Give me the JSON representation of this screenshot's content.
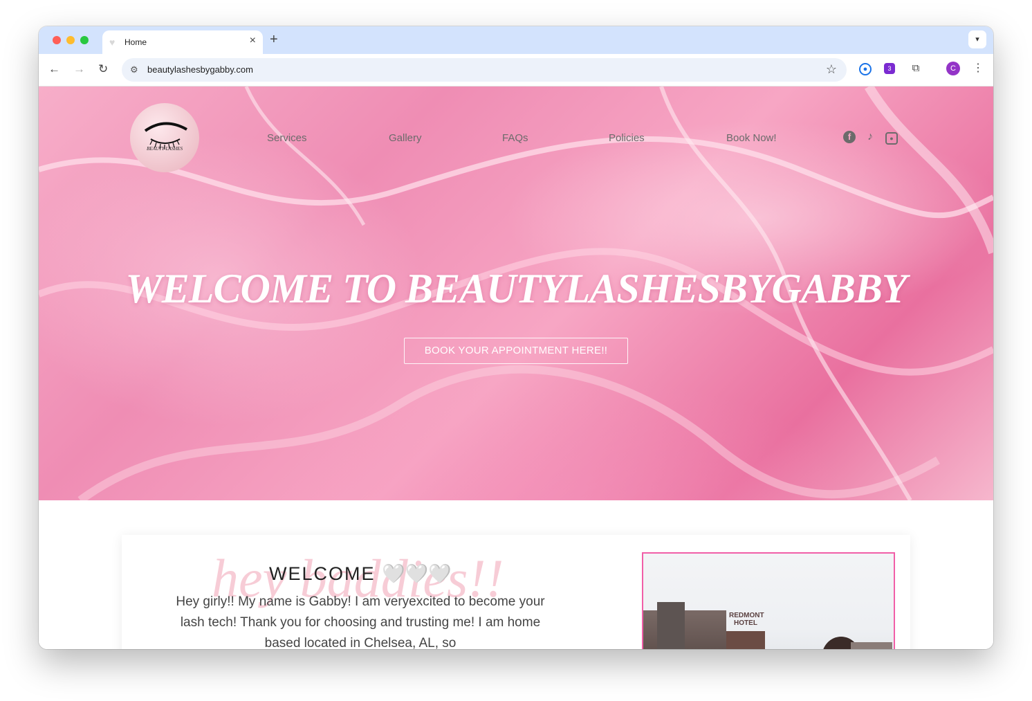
{
  "browser": {
    "tab_title": "Home",
    "new_tab_label": "+",
    "url": "beautylashesbygabby.com",
    "extension_badge": "3",
    "profile_initial": "C"
  },
  "site": {
    "logo_text": "BEAUTY LASHES",
    "nav": [
      "Services",
      "Gallery",
      "FAQs",
      "Policies",
      "Book Now!"
    ],
    "social_icons": [
      "facebook-icon",
      "tiktok-icon",
      "instagram-icon"
    ],
    "hero": {
      "title": "WELCOME TO BEAUTYLASHESBYGABBY",
      "cta": "BOOK YOUR APPOINTMENT HERE!!"
    },
    "intro": {
      "script_text": "hey baddies!!",
      "heading": "WELCOME",
      "heading_hearts": "🤍🤍🤍",
      "body": "Hey girly!! My name is Gabby! I am veryexcited to become your lash tech! Thank you for choosing and trusting me! I am home based located in Chelsea, AL, so",
      "photo_sign": "REDMONT HOTEL"
    },
    "colors": {
      "accent_pink": "#f15ea7",
      "hero_pink": "#ef8db4",
      "browser_chrome": "#d3e3fd"
    }
  }
}
